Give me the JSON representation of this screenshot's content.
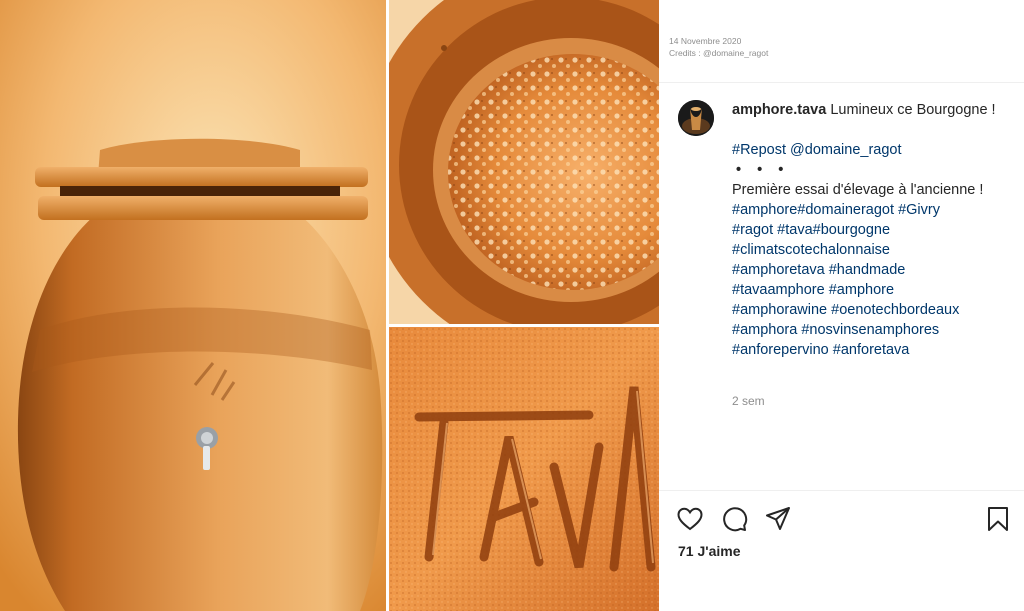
{
  "post_meta": {
    "date": "14 Novembre 2020",
    "credits": "Credits : @domaine_ragot"
  },
  "post": {
    "username": "amphore.tava",
    "caption_first": "Lumineux ce Bourgogne !",
    "repost_tag": "#Repost",
    "repost_mention": "@domaine_ragot",
    "dots": "• • •",
    "caption_second": "Première essai d'élevage à l'ancienne !",
    "hashtag_lines": [
      [
        "#amphore#domaineragot",
        "#Givry"
      ],
      [
        "#ragot",
        "#tava#bourgogne"
      ],
      [
        "#climatscotechalonnaise"
      ],
      [
        "#amphoretava",
        "#handmade"
      ],
      [
        "#tavaamphore",
        "#amphore"
      ],
      [
        "#amphorawine",
        "#oenotechbordeaux"
      ],
      [
        "#amphora",
        "#nosvinsenamphores"
      ],
      [
        "#anforepervino",
        "#anforetava"
      ]
    ],
    "time": "2 sem"
  },
  "likes": "71 J'aime",
  "icons": [
    "heart-icon",
    "comment-icon",
    "share-icon",
    "bookmark-icon"
  ],
  "colors": {
    "hashtag": "#00376b",
    "text": "#262626",
    "muted": "#8e8e8e",
    "terracotta": "#d97a2b"
  }
}
